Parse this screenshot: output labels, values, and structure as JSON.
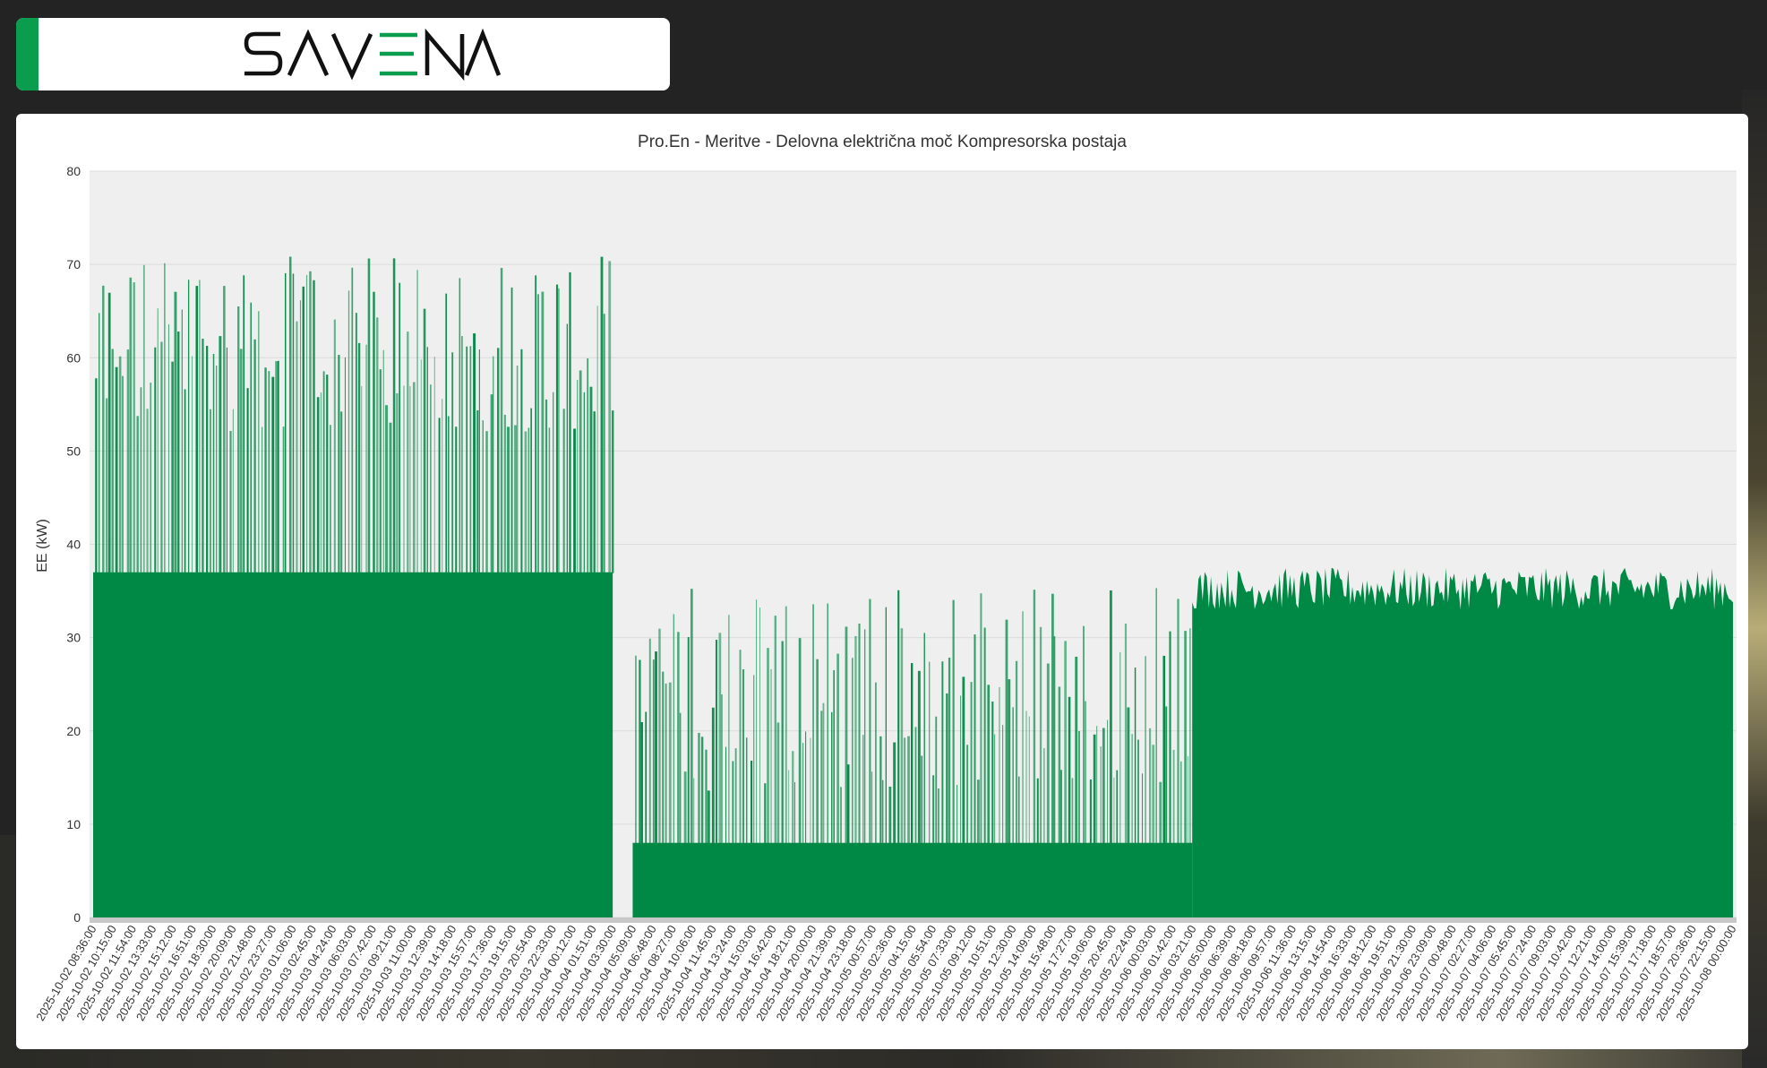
{
  "brand": {
    "name": "SAVENA",
    "accent": "#0a9d4e"
  },
  "chart_data": {
    "type": "bar",
    "title": "Pro.En - Meritve - Delovna električna moč Kompresorska postaja",
    "xlabel": "",
    "ylabel": "EE (kW)",
    "ylim": [
      0,
      80
    ],
    "yticks": [
      0,
      10,
      20,
      30,
      40,
      50,
      60,
      70,
      80
    ],
    "grid": true,
    "legend": "none",
    "plot_background": "#efefef",
    "bar_color": "#008845",
    "xticks": [
      "2025-10-02 08:36:00",
      "2025-10-02 10:15:00",
      "2025-10-02 11:54:00",
      "2025-10-02 13:33:00",
      "2025-10-02 15:12:00",
      "2025-10-02 16:51:00",
      "2025-10-02 18:30:00",
      "2025-10-02 20:09:00",
      "2025-10-02 21:48:00",
      "2025-10-02 23:27:00",
      "2025-10-03 01:06:00",
      "2025-10-03 02:45:00",
      "2025-10-03 04:24:00",
      "2025-10-03 06:03:00",
      "2025-10-03 07:42:00",
      "2025-10-03 09:21:00",
      "2025-10-03 11:00:00",
      "2025-10-03 12:39:00",
      "2025-10-03 14:18:00",
      "2025-10-03 15:57:00",
      "2025-10-03 17:36:00",
      "2025-10-03 19:15:00",
      "2025-10-03 20:54:00",
      "2025-10-03 22:33:00",
      "2025-10-04 00:12:00",
      "2025-10-04 01:51:00",
      "2025-10-04 03:30:00",
      "2025-10-04 05:09:00",
      "2025-10-04 06:48:00",
      "2025-10-04 08:27:00",
      "2025-10-04 10:06:00",
      "2025-10-04 11:45:00",
      "2025-10-04 13:24:00",
      "2025-10-04 15:03:00",
      "2025-10-04 16:42:00",
      "2025-10-04 18:21:00",
      "2025-10-04 20:00:00",
      "2025-10-04 21:39:00",
      "2025-10-04 23:18:00",
      "2025-10-05 00:57:00",
      "2025-10-05 02:36:00",
      "2025-10-05 04:15:00",
      "2025-10-05 05:54:00",
      "2025-10-05 07:33:00",
      "2025-10-05 09:12:00",
      "2025-10-05 10:51:00",
      "2025-10-05 12:30:00",
      "2025-10-05 14:09:00",
      "2025-10-05 15:48:00",
      "2025-10-05 17:27:00",
      "2025-10-05 19:06:00",
      "2025-10-05 20:45:00",
      "2025-10-05 22:24:00",
      "2025-10-06 00:03:00",
      "2025-10-06 01:42:00",
      "2025-10-06 03:21:00",
      "2025-10-06 05:00:00",
      "2025-10-06 06:39:00",
      "2025-10-06 08:18:00",
      "2025-10-06 09:57:00",
      "2025-10-06 11:36:00",
      "2025-10-06 13:15:00",
      "2025-10-06 14:54:00",
      "2025-10-06 16:33:00",
      "2025-10-06 18:12:00",
      "2025-10-06 19:51:00",
      "2025-10-06 21:30:00",
      "2025-10-06 23:09:00",
      "2025-10-07 00:48:00",
      "2025-10-07 02:27:00",
      "2025-10-07 04:06:00",
      "2025-10-07 05:45:00",
      "2025-10-07 07:24:00",
      "2025-10-07 09:03:00",
      "2025-10-07 10:42:00",
      "2025-10-07 12:21:00",
      "2025-10-07 14:00:00",
      "2025-10-07 15:39:00",
      "2025-10-07 17:18:00",
      "2025-10-07 18:57:00",
      "2025-10-07 20:36:00",
      "2025-10-07 22:15:00",
      "2025-10-08 00:00:00"
    ],
    "series": [
      {
        "segments": [
          {
            "from": "2025-10-02 08:36:00",
            "to": "2025-10-04 03:30:00",
            "baseline": 37,
            "peak_min": 52,
            "peak_max": 71,
            "cycles": 150
          },
          {
            "from": "2025-10-04 03:30:00",
            "to": "2025-10-04 05:09:00",
            "baseline": 0,
            "peak_min": 0,
            "peak_max": 0,
            "cycles": 0
          },
          {
            "from": "2025-10-04 05:09:00",
            "to": "2025-10-06 03:21:00",
            "baseline": 8,
            "peak_min": 13,
            "peak_max": 36,
            "cycles": 160
          },
          {
            "from": "2025-10-06 03:21:00",
            "to": "2025-10-08 00:00:00",
            "baseline": 35,
            "peak_min": 33,
            "peak_max": 37.5,
            "cycles": 0
          }
        ]
      }
    ]
  }
}
